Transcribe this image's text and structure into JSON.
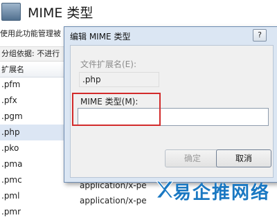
{
  "background": {
    "title": "MIME 类型",
    "description": "使用此功能管理被",
    "group_by": "分组依据:  不进行",
    "column_header": "扩展名",
    "extensions": [
      ".pfm",
      ".pfx",
      ".pgm",
      ".php",
      ".pko",
      ".pma",
      ".pmc",
      ".pml",
      ".pmr"
    ],
    "selected_extension": ".php",
    "mime_values": [
      "application/x-pe",
      "application/x-pe"
    ]
  },
  "dialog": {
    "title": "编辑 MIME 类型",
    "help_label": "?",
    "extension_label": "文件扩展名(E):",
    "extension_value": ".php",
    "mime_label": "MIME 类型(M):",
    "mime_value": "",
    "ok_label": "确定",
    "cancel_label": "取消"
  },
  "watermark": {
    "text": "易企推网络"
  },
  "colors": {
    "highlight_box": "#d22a2a",
    "dialog_frame": "#dbe6f3",
    "watermark": "#1a78c2"
  }
}
